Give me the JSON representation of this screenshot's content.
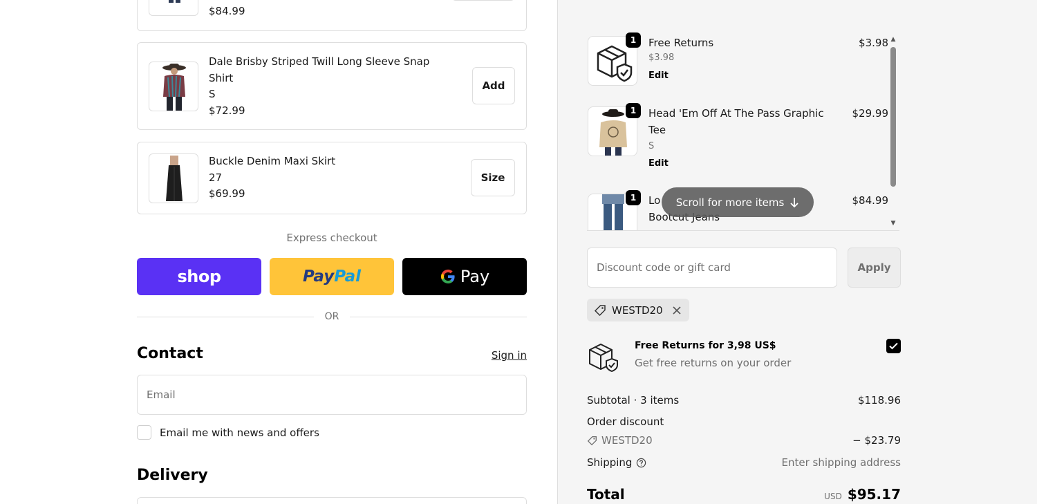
{
  "upsells": [
    {
      "price": "$84.99"
    },
    {
      "title": "Dale Brisby Striped Twill Long Sleeve Snap Shirt",
      "variant": "S",
      "price": "$72.99",
      "button": "Add"
    },
    {
      "title": "Buckle Denim Maxi Skirt",
      "variant": "27",
      "price": "$69.99",
      "button": "Size"
    }
  ],
  "express": {
    "label": "Express checkout",
    "shop_label": "shop",
    "paypal_label": "PayPal",
    "gpay_label": "Pay",
    "or_label": "OR"
  },
  "contact": {
    "heading": "Contact",
    "sign_in": "Sign in",
    "email_placeholder": "Email",
    "news_label": "Email me with news and offers"
  },
  "delivery": {
    "heading": "Delivery"
  },
  "cart": {
    "items": [
      {
        "qty": "1",
        "name": "Free Returns",
        "sub": "$3.98",
        "edit": "Edit",
        "price": "$3.98"
      },
      {
        "qty": "1",
        "name": "Head 'Em Off At The Pass Graphic Tee",
        "sub": "S",
        "edit": "Edit",
        "price": "$29.99"
      },
      {
        "qty": "1",
        "name": "Lo",
        "name_line2": "Bootcut Jeans",
        "price": "$84.99"
      }
    ],
    "scroll_hint": "Scroll for more items"
  },
  "discount": {
    "placeholder": "Discount code or gift card",
    "apply": "Apply",
    "applied_code": "WESTD20"
  },
  "returns_offer": {
    "title": "Free Returns for 3,98 US$",
    "subtitle": "Get free returns on your order",
    "checked": true
  },
  "summary": {
    "subtotal_label": "Subtotal · 3 items",
    "subtotal_value": "$118.96",
    "order_discount_label": "Order discount",
    "discount_code": "WESTD20",
    "discount_value": "− $23.79",
    "shipping_label": "Shipping",
    "shipping_value": "Enter shipping address",
    "total_label": "Total",
    "total_currency": "USD",
    "total_value": "$95.17"
  },
  "colors": {
    "shop": "#5a31f4",
    "paypal": "#ffc439",
    "gpay": "#000000",
    "panel_bg": "#f5f5f5"
  }
}
